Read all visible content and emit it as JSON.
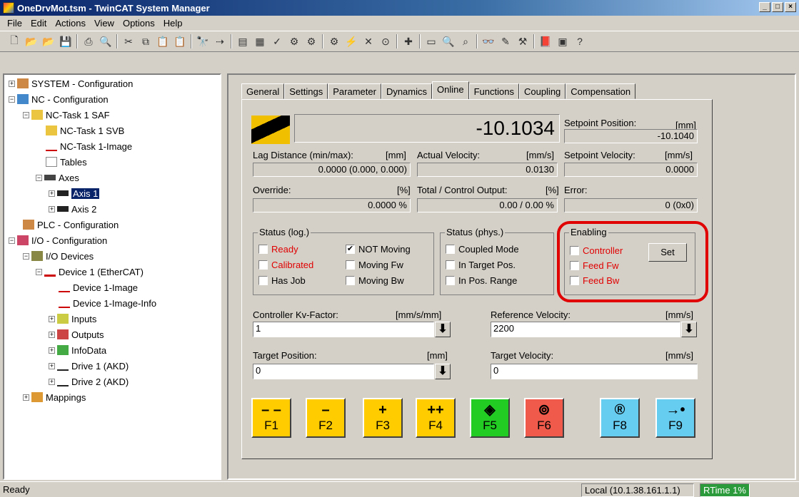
{
  "window": {
    "title": "OneDrvMot.tsm - TwinCAT System Manager"
  },
  "menu": [
    "File",
    "Edit",
    "Actions",
    "View",
    "Options",
    "Help"
  ],
  "tree": [
    {
      "label": "SYSTEM - Configuration"
    },
    {
      "label": "NC - Configuration"
    },
    {
      "label": "NC-Task 1 SAF"
    },
    {
      "label": "NC-Task 1 SVB"
    },
    {
      "label": "NC-Task 1-Image"
    },
    {
      "label": "Tables"
    },
    {
      "label": "Axes"
    },
    {
      "label": "Axis 1"
    },
    {
      "label": "Axis 2"
    },
    {
      "label": "PLC - Configuration"
    },
    {
      "label": "I/O - Configuration"
    },
    {
      "label": "I/O Devices"
    },
    {
      "label": "Device 1 (EtherCAT)"
    },
    {
      "label": "Device 1-Image"
    },
    {
      "label": "Device 1-Image-Info"
    },
    {
      "label": "Inputs"
    },
    {
      "label": "Outputs"
    },
    {
      "label": "InfoData"
    },
    {
      "label": "Drive 1 (AKD)"
    },
    {
      "label": "Drive 2 (AKD)"
    },
    {
      "label": "Mappings"
    }
  ],
  "tabs": [
    "General",
    "Settings",
    "Parameter",
    "Dynamics",
    "Online",
    "Functions",
    "Coupling",
    "Compensation"
  ],
  "online": {
    "position_value": "-10.1034",
    "setpoint_position_label": "Setpoint Position:",
    "setpoint_position_unit": "[mm]",
    "setpoint_position_value": "-10.1040",
    "lag_label": "Lag Distance (min/max):",
    "lag_unit": "[mm]",
    "lag_value": "0.0000  (0.000, 0.000)",
    "actual_velocity_label": "Actual Velocity:",
    "actual_velocity_unit": "[mm/s]",
    "actual_velocity_value": "0.0130",
    "setpoint_velocity_label": "Setpoint Velocity:",
    "setpoint_velocity_unit": "[mm/s]",
    "setpoint_velocity_value": "0.0000",
    "override_label": "Override:",
    "override_unit": "[%]",
    "override_value": "0.0000 %",
    "total_output_label": "Total / Control Output:",
    "total_output_unit": "[%]",
    "total_output_value": "0.00 /  0.00 %",
    "error_label": "Error:",
    "error_value": "0 (0x0)",
    "status_log_title": "Status (log.)",
    "status_log": [
      {
        "label": "Ready",
        "checked": false,
        "red": true
      },
      {
        "label": "Calibrated",
        "checked": false,
        "red": true
      },
      {
        "label": "Has Job",
        "checked": false,
        "red": false
      },
      {
        "label": "NOT Moving",
        "checked": true,
        "red": false
      },
      {
        "label": "Moving Fw",
        "checked": false,
        "red": false
      },
      {
        "label": "Moving Bw",
        "checked": false,
        "red": false
      }
    ],
    "status_phys_title": "Status (phys.)",
    "status_phys": [
      {
        "label": "Coupled Mode",
        "checked": false
      },
      {
        "label": "In Target Pos.",
        "checked": false
      },
      {
        "label": "In Pos. Range",
        "checked": false
      }
    ],
    "enabling_title": "Enabling",
    "enabling": [
      {
        "label": "Controller",
        "checked": false
      },
      {
        "label": "Feed Fw",
        "checked": false
      },
      {
        "label": "Feed Bw",
        "checked": false
      }
    ],
    "set_button": "Set",
    "kv_label": "Controller Kv-Factor:",
    "kv_unit": "[mm/s/mm]",
    "kv_value": "1",
    "ref_velocity_label": "Reference Velocity:",
    "ref_velocity_unit": "[mm/s]",
    "ref_velocity_value": "2200",
    "target_position_label": "Target Position:",
    "target_position_unit": "[mm]",
    "target_position_value": "0",
    "target_velocity_label": "Target Velocity:",
    "target_velocity_unit": "[mm/s]",
    "target_velocity_value": "0",
    "fkeys": [
      {
        "sym": "– –",
        "label": "F1",
        "color": "#ffcc00"
      },
      {
        "sym": "–",
        "label": "F2",
        "color": "#ffcc00"
      },
      {
        "sym": "+",
        "label": "F3",
        "color": "#ffcc00"
      },
      {
        "sym": "++",
        "label": "F4",
        "color": "#ffcc00"
      },
      {
        "sym": "◈",
        "label": "F5",
        "color": "#22cc22"
      },
      {
        "sym": "⊚",
        "label": "F6",
        "color": "#f05a4a"
      },
      {
        "sym": "®",
        "label": "F8",
        "color": "#66ccf0"
      },
      {
        "sym": "→•",
        "label": "F9",
        "color": "#66ccf0"
      }
    ]
  },
  "status": {
    "left": "Ready",
    "address": "Local (10.1.38.161.1.1)",
    "rtime": "RTime 1%"
  },
  "colors": {
    "highlight_ring": "#e00000",
    "titlebar": "#0a246a"
  }
}
